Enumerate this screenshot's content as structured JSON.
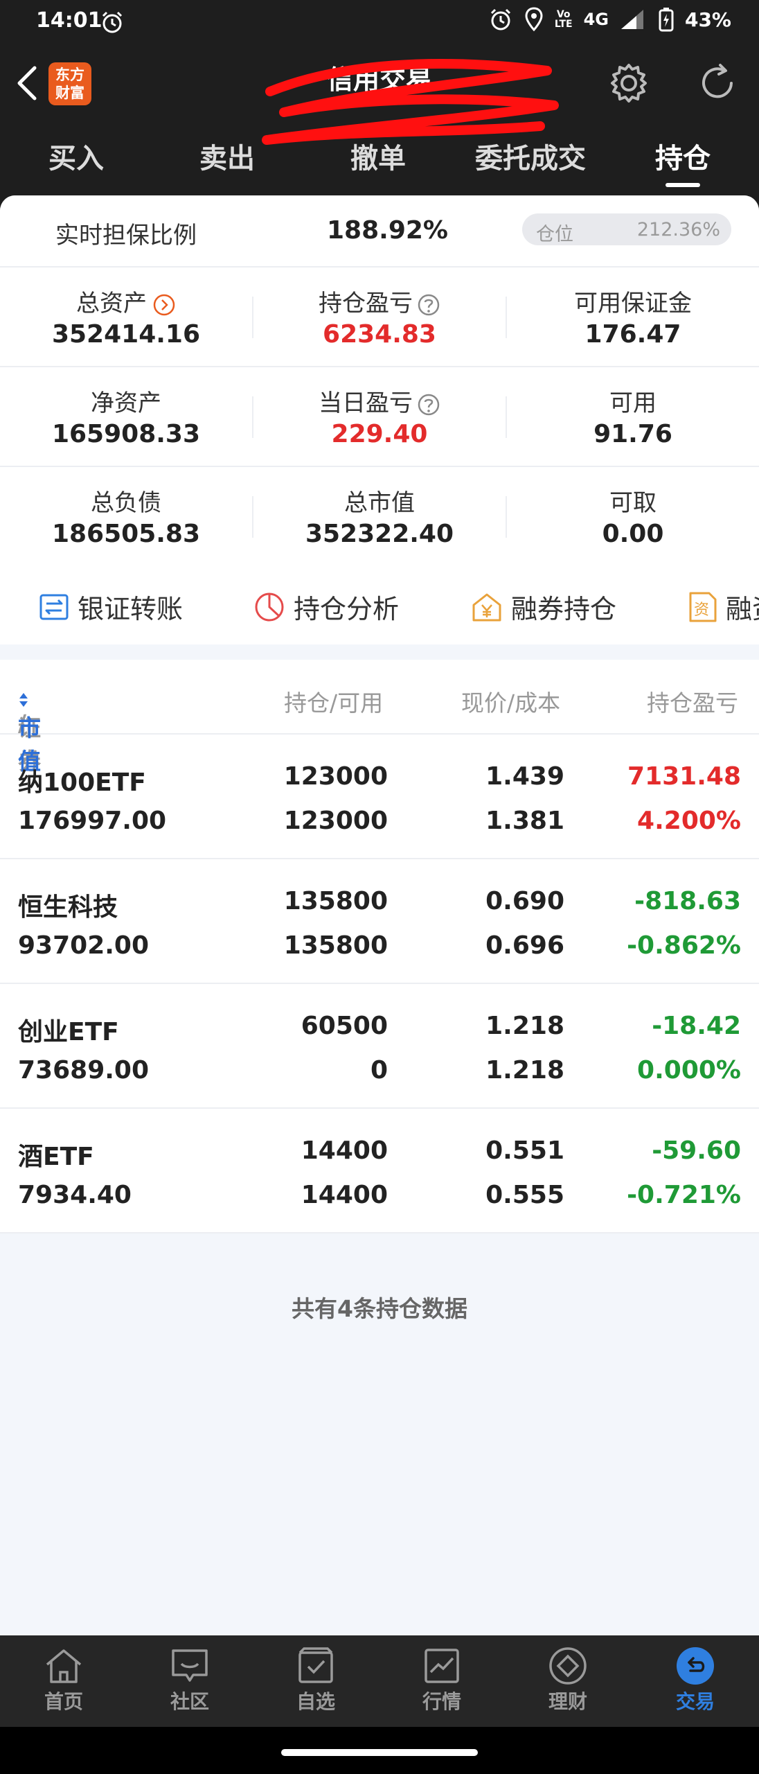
{
  "status_bar": {
    "time": "14:01",
    "network": "4G",
    "lte_top": "Vo",
    "lte_bottom": "LTE",
    "battery": "43%"
  },
  "header": {
    "logo_line1": "东方",
    "logo_line2": "财富",
    "title": "信用交易"
  },
  "tabs": [
    {
      "label": "买入"
    },
    {
      "label": "卖出"
    },
    {
      "label": "撤单"
    },
    {
      "label": "委托成交"
    },
    {
      "label": "持仓"
    }
  ],
  "summary": {
    "ratio_label": "实时担保比例",
    "ratio_value": "188.92%",
    "position_label": "仓位",
    "position_value": "212.36%",
    "metrics": [
      {
        "label": "总资产",
        "value": "352414.16"
      },
      {
        "label": "持仓盈亏",
        "value": "6234.83"
      },
      {
        "label": "可用保证金",
        "value": "176.47"
      },
      {
        "label": "净资产",
        "value": "165908.33"
      },
      {
        "label": "当日盈亏",
        "value": "229.40"
      },
      {
        "label": "可用",
        "value": "91.76"
      },
      {
        "label": "总负债",
        "value": "186505.83"
      },
      {
        "label": "总市值",
        "value": "352322.40"
      },
      {
        "label": "可取",
        "value": "0.00"
      }
    ]
  },
  "quick_actions": [
    {
      "label": "银证转账"
    },
    {
      "label": "持仓分析"
    },
    {
      "label": "融券持仓"
    },
    {
      "label": "融资"
    }
  ],
  "holdings": {
    "header": {
      "security": "证券",
      "sep": "/",
      "market_value": "市值",
      "holding": "持仓/可用",
      "price": "现价/成本",
      "pnl": "持仓盈亏"
    },
    "rows": [
      {
        "name": "纳100ETF",
        "market_value": "176997.00",
        "holding": "123000",
        "available": "123000",
        "price": "1.439",
        "cost": "1.381",
        "pnl": "7131.48",
        "pnl_pct": "4.200%"
      },
      {
        "name": "恒生科技",
        "market_value": "93702.00",
        "holding": "135800",
        "available": "135800",
        "price": "0.690",
        "cost": "0.696",
        "pnl": "-818.63",
        "pnl_pct": "-0.862%"
      },
      {
        "name": "创业ETF",
        "market_value": "73689.00",
        "holding": "60500",
        "available": "0",
        "price": "1.218",
        "cost": "1.218",
        "pnl": "-18.42",
        "pnl_pct": "0.000%"
      },
      {
        "name": "酒ETF",
        "market_value": "7934.40",
        "holding": "14400",
        "available": "14400",
        "price": "0.551",
        "cost": "0.555",
        "pnl": "-59.60",
        "pnl_pct": "-0.721%"
      }
    ],
    "footer": "共有4条持仓数据"
  },
  "bottom_nav": [
    {
      "label": "首页",
      "icon": "home-icon"
    },
    {
      "label": "社区",
      "icon": "chat-icon"
    },
    {
      "label": "自选",
      "icon": "watchlist-icon"
    },
    {
      "label": "行情",
      "icon": "chart-icon"
    },
    {
      "label": "理财",
      "icon": "diamond-icon"
    },
    {
      "label": "交易",
      "icon": "trade-icon"
    }
  ],
  "colors": {
    "accent_blue": "#2f7fe0",
    "up_red": "#e32b2b",
    "down_green": "#1f9a36",
    "brand_orange": "#e95b1e"
  }
}
